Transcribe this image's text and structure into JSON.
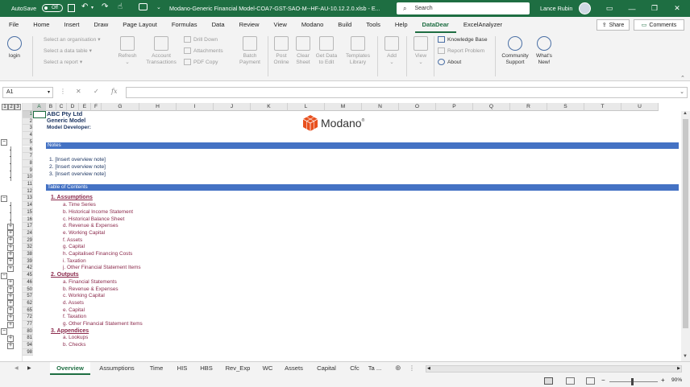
{
  "titlebar": {
    "autosave_label": "AutoSave",
    "autosave_state": "Off",
    "filename": "Modano-Generic Financial Model-COA7-GST-SAO-M--HF-AU-10.12.2.0.xlsb - E...",
    "search_placeholder": "Search",
    "user_name": "Lance Rubin"
  },
  "menu": {
    "tabs": [
      "File",
      "Home",
      "Insert",
      "Draw",
      "Page Layout",
      "Formulas",
      "Data",
      "Review",
      "View",
      "Modano",
      "Build",
      "Tools",
      "Help",
      "DataDear",
      "ExcelAnalyzer"
    ],
    "share": "Share",
    "comments": "Comments"
  },
  "ribbon": {
    "login": "login",
    "select_organisation": "Select an organisation",
    "select_data_table": "Select a data table",
    "select_report": "Select a report",
    "refresh": "Refresh",
    "account": [
      "Account",
      "Transactions"
    ],
    "drill_down": "Drill Down",
    "attachments": "Attachments",
    "pdf_copy": "PDF Copy",
    "batch": [
      "Batch",
      "Payment"
    ],
    "post": [
      "Post",
      "Online"
    ],
    "clear": [
      "Clear",
      "Sheet"
    ],
    "get_data": [
      "Get Data",
      "to Edit"
    ],
    "templates": [
      "Templates",
      "Library"
    ],
    "add": "Add",
    "view": "View",
    "knowledge_base": "Knowledge Base",
    "report_problem": "Report Problem",
    "about": "About",
    "community": [
      "Community",
      "Support"
    ],
    "whats_new": [
      "What's",
      "New!"
    ]
  },
  "formula_bar": {
    "name_box": "A1",
    "fx": "fx"
  },
  "columns": [
    "A",
    "B",
    "C",
    "D",
    "E",
    "F",
    "G",
    "H",
    "I",
    "J",
    "K",
    "L",
    "M",
    "N",
    "O",
    "P",
    "Q",
    "R",
    "S",
    "T",
    "U"
  ],
  "outline_levels": [
    "1",
    "2",
    "3"
  ],
  "rows": [
    "1",
    "2",
    "3",
    "4",
    "5",
    "6",
    "7",
    "8",
    "9",
    "10",
    "11",
    "12",
    "13",
    "14",
    "15",
    "16",
    "17",
    "24",
    "29",
    "32",
    "38",
    "39",
    "42",
    "45",
    "46",
    "50",
    "57",
    "62",
    "65",
    "72",
    "77",
    "80",
    "81",
    "94",
    "98"
  ],
  "sheet": {
    "company": "ABC Pty Ltd",
    "model": "Generic Model",
    "developer": "Model Developer:",
    "logo_text": "Modano",
    "logo_reg": "®",
    "notes_header": "Notes",
    "notes": [
      "1.  [Insert overview note]",
      "2.  [Insert overview note]",
      "3.  [Insert overview note]"
    ],
    "toc_header": "Table of Contents",
    "sections": [
      {
        "title": "1.  Assumptions",
        "items": [
          "a.  Time Series",
          "b.  Historical Income Statement",
          "c.  Historical Balance Sheet",
          "d.  Revenue & Expenses",
          "e.  Working Capital",
          "f.  Assets",
          "g.  Capital",
          "h.  Capitalised Financing Costs",
          "i.  Taxation",
          "j.  Other Financial Statement Items"
        ]
      },
      {
        "title": "2.  Outputs",
        "items": [
          "a.  Financial Statements",
          "b.  Revenue & Expenses",
          "c.  Working Capital",
          "d.  Assets",
          "e.  Capital",
          "f.  Taxation",
          "g.  Other Financial Statement Items"
        ]
      },
      {
        "title": "3.  Appendices",
        "items": [
          "a.  Lookups",
          "b.  Checks"
        ]
      }
    ]
  },
  "sheet_tabs": [
    "Overview",
    "Assumptions",
    "Time",
    "HIS",
    "HBS",
    "Rev_Exp",
    "WC",
    "Assets",
    "Capital",
    "Cfc",
    "Ta ..."
  ],
  "status": {
    "zoom": "90%"
  },
  "colors": {
    "excel_green": "#1e6e42",
    "header_blue": "#4472c4",
    "link": "#8b2a4c",
    "modano_orange": "#e8501e"
  }
}
